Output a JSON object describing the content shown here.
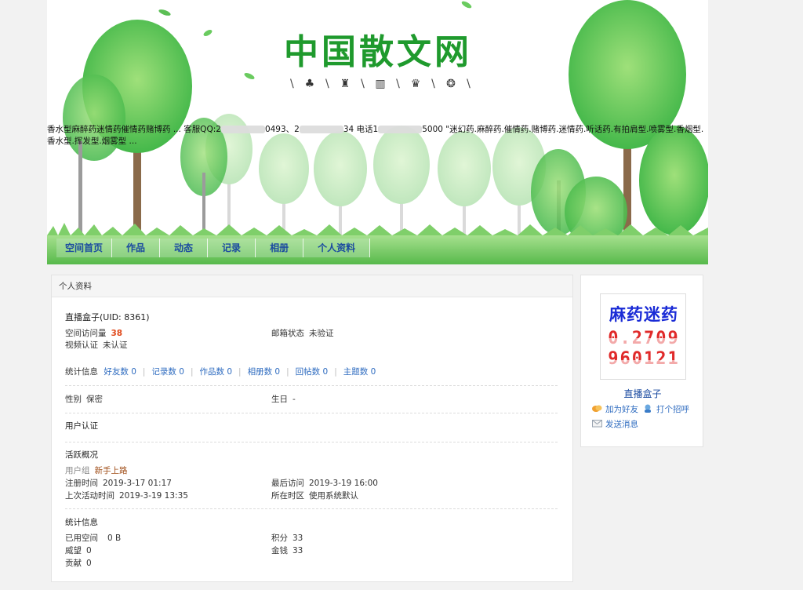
{
  "header": {
    "site_title": "中国散文网",
    "marquee_part1": "香水型麻醉药迷情药催情药赌博药 ... 客服QQ:2",
    "marquee_part2": "0493、2",
    "marquee_part3": "34 电话1",
    "marquee_part4": "5000 \"迷幻药.麻醉药.催情药.赌博药.迷情药.听话药.有拍肩型.喷雾型.香烟型.香水型.挥发型.烟雾型 ...",
    "nav": [
      "空间首页",
      "作品",
      "动态",
      "记录",
      "相册",
      "个人资料"
    ]
  },
  "panel": {
    "title": "个人资料",
    "username": "直播盒子(UID: 8361)",
    "visits_label": "空间访问量",
    "visits_value": "38",
    "email_label": "邮箱状态",
    "email_value": "未验证",
    "video_label": "视频认证",
    "video_value": "未认证",
    "stats_label": "统计信息",
    "stats": [
      {
        "label": "好友数",
        "value": "0"
      },
      {
        "label": "记录数",
        "value": "0"
      },
      {
        "label": "作品数",
        "value": "0"
      },
      {
        "label": "相册数",
        "value": "0"
      },
      {
        "label": "回帖数",
        "value": "0"
      },
      {
        "label": "主题数",
        "value": "0"
      }
    ],
    "gender_label": "性别",
    "gender_value": "保密",
    "birthday_label": "生日",
    "birthday_value": "-",
    "cert_label": "用户认证",
    "activity_title": "活跃概况",
    "group_label": "用户组",
    "group_value": "新手上路",
    "reg_label": "注册时间",
    "reg_value": "2019-3-17 01:17",
    "lastvisit_label": "最后访问",
    "lastvisit_value": "2019-3-19 16:00",
    "lastactive_label": "上次活动时间",
    "lastactive_value": "2019-3-19 13:35",
    "timezone_label": "所在时区",
    "timezone_value": "使用系统默认",
    "info_title": "统计信息",
    "space_label": "已用空间",
    "space_value": "0 B",
    "points_label": "积分",
    "points_value": "33",
    "prestige_label": "威望",
    "prestige_value": "0",
    "money_label": "金钱",
    "money_value": "33",
    "contrib_label": "贡献",
    "contrib_value": "0"
  },
  "sidebar": {
    "avatar_line1": "麻药迷药",
    "avatar_line2": "0.2709",
    "avatar_line3": "960121",
    "name": "直播盒子",
    "add_friend": "加为好友",
    "greet": "打个招呼",
    "message": "发送消息"
  },
  "colors": {
    "title_green": "#1f9a2d",
    "nav_blue": "#1a4aa0",
    "link_blue": "#2f6cc0",
    "visits_red": "#e04a1c",
    "group_brown": "#a04e18"
  }
}
